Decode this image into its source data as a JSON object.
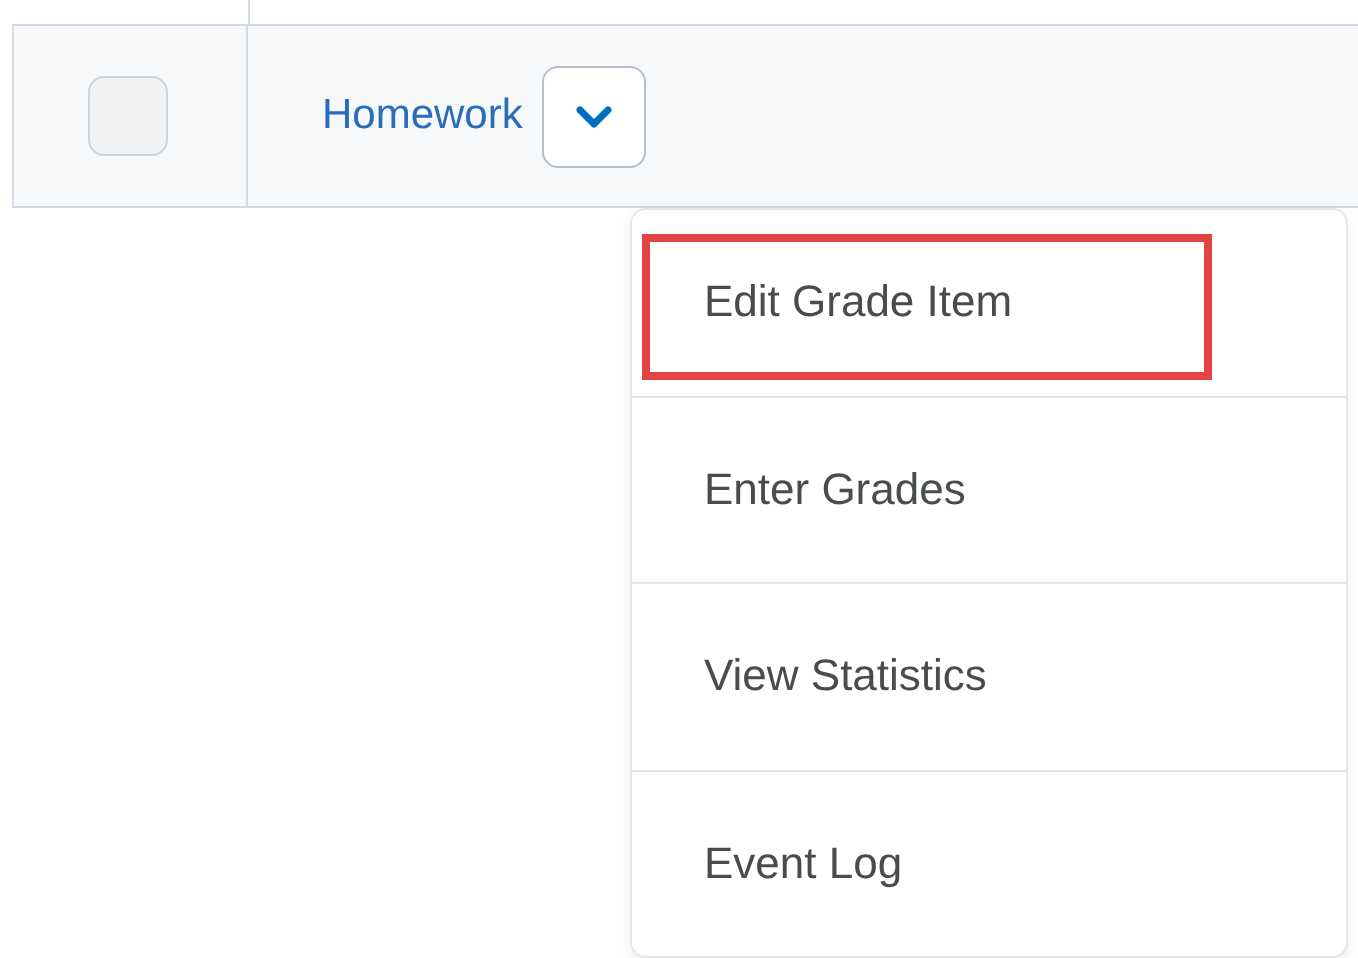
{
  "row": {
    "checked": false,
    "title": "Homework"
  },
  "menu": {
    "open": true,
    "items": [
      {
        "label": "Edit Grade Item",
        "highlighted": true
      },
      {
        "label": "Enter Grades",
        "highlighted": false
      },
      {
        "label": "View Statistics",
        "highlighted": false
      },
      {
        "label": "Event Log",
        "highlighted": false
      }
    ]
  }
}
